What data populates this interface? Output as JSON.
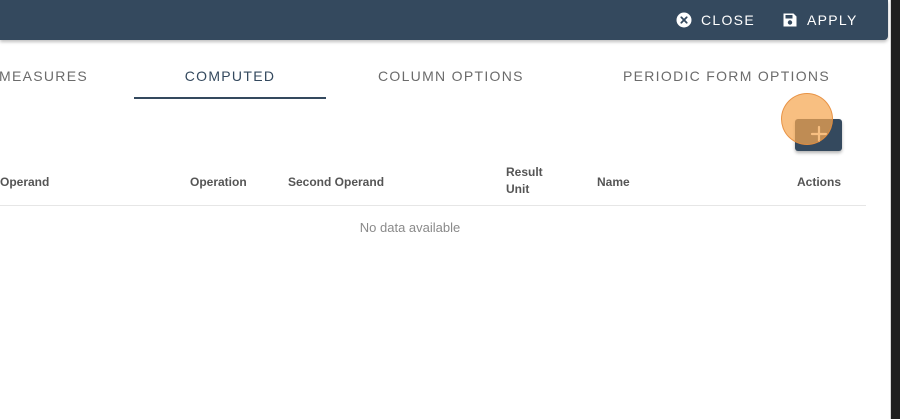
{
  "toolbar": {
    "close_label": "CLOSE",
    "apply_label": "APPLY",
    "close_icon": "close-circle-icon",
    "apply_icon": "save-floppy-icon"
  },
  "tabs": [
    {
      "label": "MEASURES",
      "active": false
    },
    {
      "label": "COMPUTED",
      "active": true
    },
    {
      "label": "COLUMN OPTIONS",
      "active": false
    },
    {
      "label": "PERIODIC FORM OPTIONS",
      "active": false
    }
  ],
  "add_button": {
    "icon": "plus-icon"
  },
  "table": {
    "headers": [
      {
        "label": "Operand",
        "label2": ""
      },
      {
        "label": "Operation",
        "label2": ""
      },
      {
        "label": "Second Operand",
        "label2": ""
      },
      {
        "label": "Result",
        "label2": "Unit"
      },
      {
        "label": "Name",
        "label2": ""
      },
      {
        "label": "Actions",
        "label2": ""
      }
    ],
    "empty_message": "No data available"
  },
  "colors": {
    "primary": "#34495e",
    "tab_inactive": "#6b6b6b",
    "header_text": "#555555",
    "empty_text": "#8a8a8a",
    "click_highlight": "#f5a650"
  }
}
